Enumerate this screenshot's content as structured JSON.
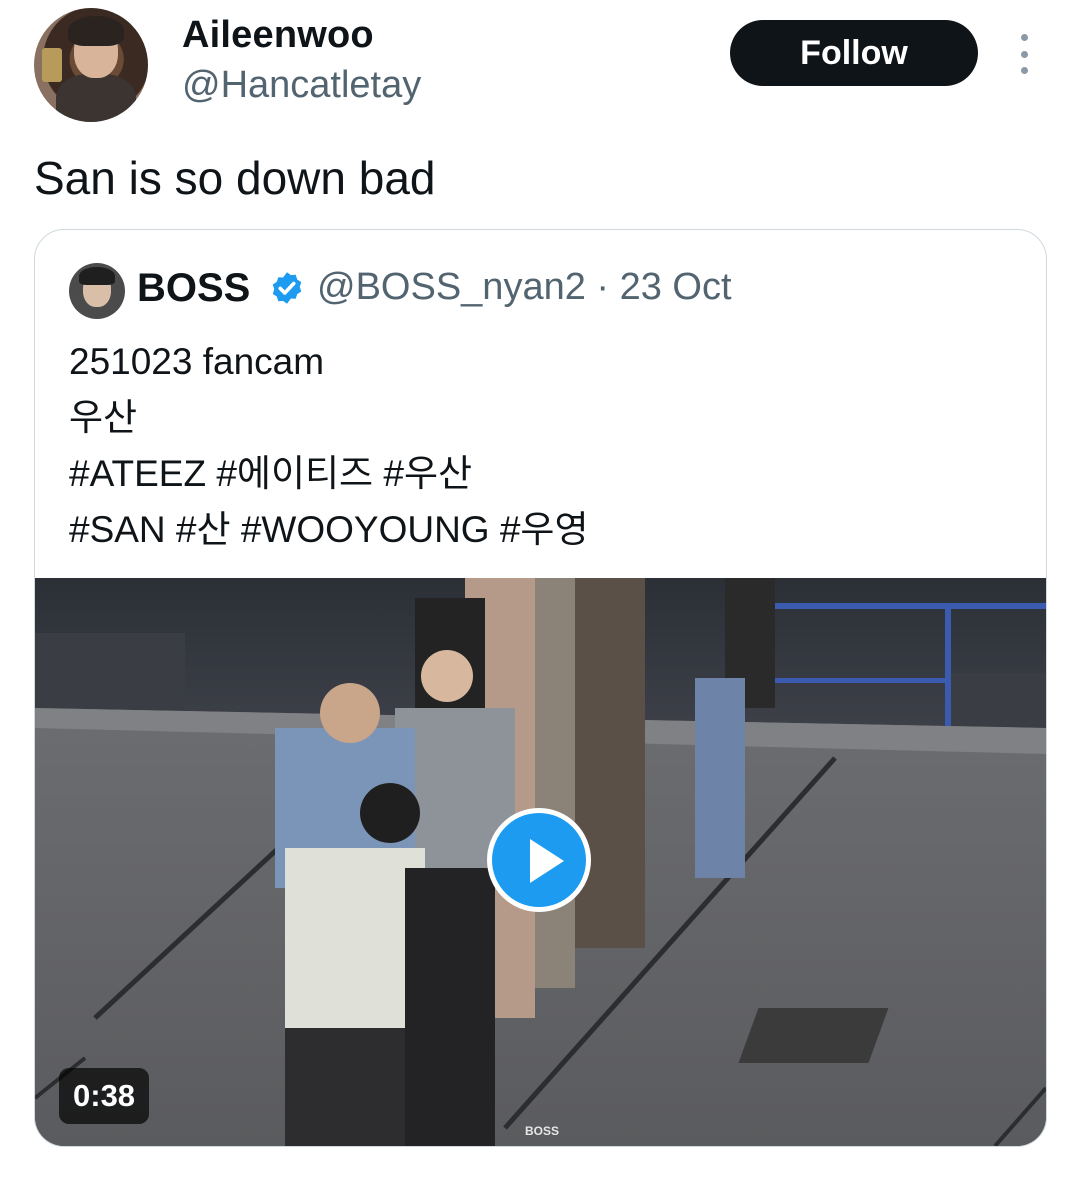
{
  "author": {
    "display_name": "Aileenwoo",
    "handle": "@Hancatletay",
    "follow_label": "Follow"
  },
  "tweet": {
    "text": "San is so down bad"
  },
  "quoted": {
    "name": "BOSS",
    "handle_date": "@BOSS_nyan2 · 23 Oct",
    "lines": [
      "251023 fancam",
      "우산",
      "#ATEEZ #에이티즈 #우산",
      "#SAN #산 #WOOYOUNG #우영"
    ],
    "media": {
      "duration": "0:38",
      "watermark": "BOSS"
    }
  },
  "colors": {
    "follow_bg": "#0f1419",
    "play_button": "#1d9bf0",
    "verified": "#1d9bf0",
    "secondary_text": "#536471"
  },
  "icons": [
    "avatar",
    "more-icon",
    "verified-badge-icon",
    "play-icon"
  ]
}
